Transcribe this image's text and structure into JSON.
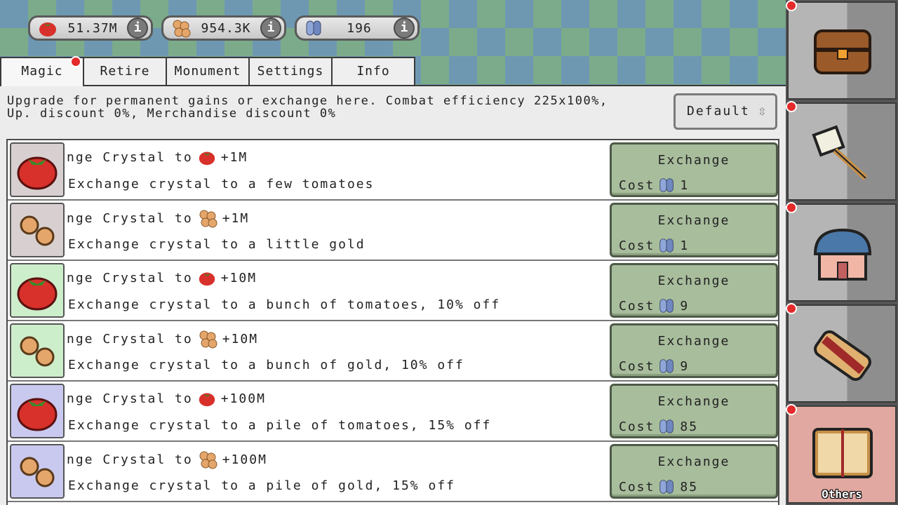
{
  "resources": [
    {
      "icon": "tomato-icon",
      "value": "51.37M"
    },
    {
      "icon": "gold-coins-icon",
      "value": "954.3K"
    },
    {
      "icon": "crystal-icon",
      "value": "196"
    }
  ],
  "info_glyph": "i",
  "tabs": [
    "Magic",
    "Retire",
    "Monument",
    "Settings",
    "Info"
  ],
  "description": "Upgrade for permanent gains or exchange here. Combat efficiency 225x100%, Up. discount 0%, Merchandise discount 0%",
  "default_button": {
    "label": "Default",
    "sort_glyph": "⇳"
  },
  "exchange_items": [
    {
      "title_prefix": "nge Crystal to",
      "resource": "tomato",
      "amount": "+1M",
      "subtitle": "Exchange crystal to a few tomatoes",
      "button": "Exchange",
      "cost_label": "Cost",
      "cost": "1",
      "thumb_bg": "#d8d0d0"
    },
    {
      "title_prefix": "nge Crystal to",
      "resource": "gold",
      "amount": "+1M",
      "subtitle": "Exchange crystal to a little gold",
      "button": "Exchange",
      "cost_label": "Cost",
      "cost": "1",
      "thumb_bg": "#d8d0d0"
    },
    {
      "title_prefix": "nge Crystal to",
      "resource": "tomato",
      "amount": "+10M",
      "subtitle": "Exchange crystal to a bunch of tomatoes, 10% off",
      "button": "Exchange",
      "cost_label": "Cost",
      "cost": "9",
      "thumb_bg": "#cdeecb"
    },
    {
      "title_prefix": "nge Crystal to",
      "resource": "gold",
      "amount": "+10M",
      "subtitle": "Exchange crystal to a bunch of gold, 10% off",
      "button": "Exchange",
      "cost_label": "Cost",
      "cost": "9",
      "thumb_bg": "#cdeecb"
    },
    {
      "title_prefix": "nge Crystal to",
      "resource": "tomato",
      "amount": "+100M",
      "subtitle": "Exchange crystal to a pile of tomatoes, 15% off",
      "button": "Exchange",
      "cost_label": "Cost",
      "cost": "85",
      "thumb_bg": "#c9c9f0"
    },
    {
      "title_prefix": "nge Crystal to",
      "resource": "gold",
      "amount": "+100M",
      "subtitle": "Exchange crystal to a pile of gold, 15% off",
      "button": "Exchange",
      "cost_label": "Cost",
      "cost": "85",
      "thumb_bg": "#c9c9f0"
    }
  ],
  "sidebar": [
    {
      "icon": "treasure-chest-icon"
    },
    {
      "icon": "hammer-icon"
    },
    {
      "icon": "house-icon"
    },
    {
      "icon": "scroll-icon"
    },
    {
      "icon": "book-icon",
      "label": "Others"
    }
  ],
  "colors": {
    "notify_dot": "#e42a2a",
    "exchange_button": "#a8bd9c",
    "active_sidebar": "#e0a8a0"
  }
}
